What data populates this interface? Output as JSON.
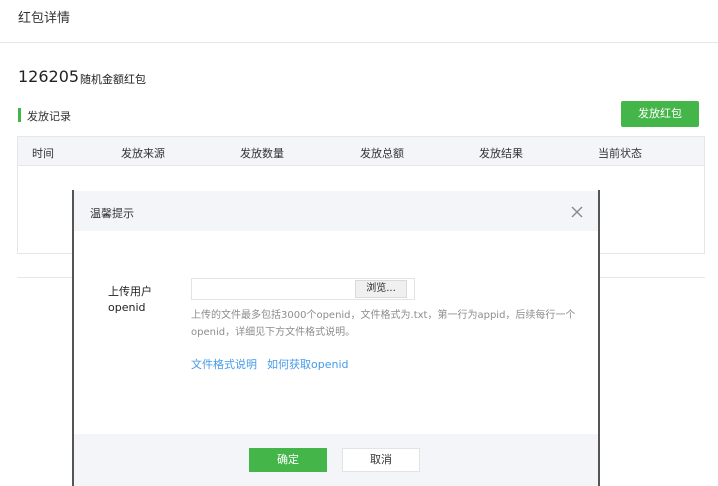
{
  "header": {
    "title": "红包详情"
  },
  "packet": {
    "id": "126205",
    "type": "随机金额红包"
  },
  "section": {
    "title": "发放记录",
    "send_button": "发放红包"
  },
  "table": {
    "columns": [
      "时间",
      "发放来源",
      "发放数量",
      "发放总额",
      "发放结果",
      "当前状态"
    ]
  },
  "modal": {
    "title": "温馨提示",
    "field_label": "上传用户openid",
    "file_value": "",
    "browse_label": "浏览...",
    "help_text": "上传的文件最多包括3000个openid，文件格式为.txt，第一行为appid，后续每行一个openid，详细见下方文件格式说明。",
    "links": {
      "format": "文件格式说明",
      "openid": "如何获取openid"
    },
    "confirm_label": "确定",
    "cancel_label": "取消"
  },
  "icons": {
    "close": "close-icon"
  },
  "colors": {
    "accent": "#44b549",
    "link": "#459ae9",
    "header_bg": "#f4f5f9"
  }
}
